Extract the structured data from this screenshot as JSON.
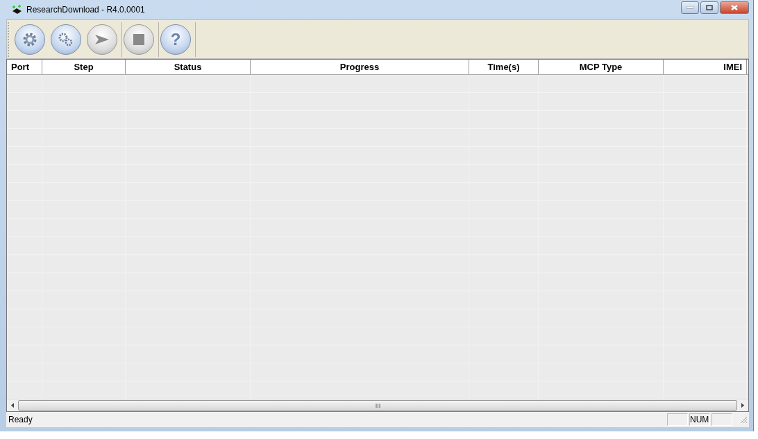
{
  "window": {
    "title": "ResearchDownload - R4.0.0001"
  },
  "toolbar": [
    {
      "kind": "gear",
      "disabled": false
    },
    {
      "kind": "gears",
      "disabled": false
    },
    {
      "kind": "play",
      "disabled": true
    },
    {
      "kind": "stop",
      "disabled": true
    },
    {
      "kind": "help",
      "label": "?",
      "disabled": false
    }
  ],
  "table": {
    "columns": [
      "Port",
      "Step",
      "Status",
      "Progress",
      "Time(s)",
      "MCP Type",
      "IMEI"
    ]
  },
  "status_bar": {
    "text": "Ready",
    "indicator": "NUM"
  }
}
